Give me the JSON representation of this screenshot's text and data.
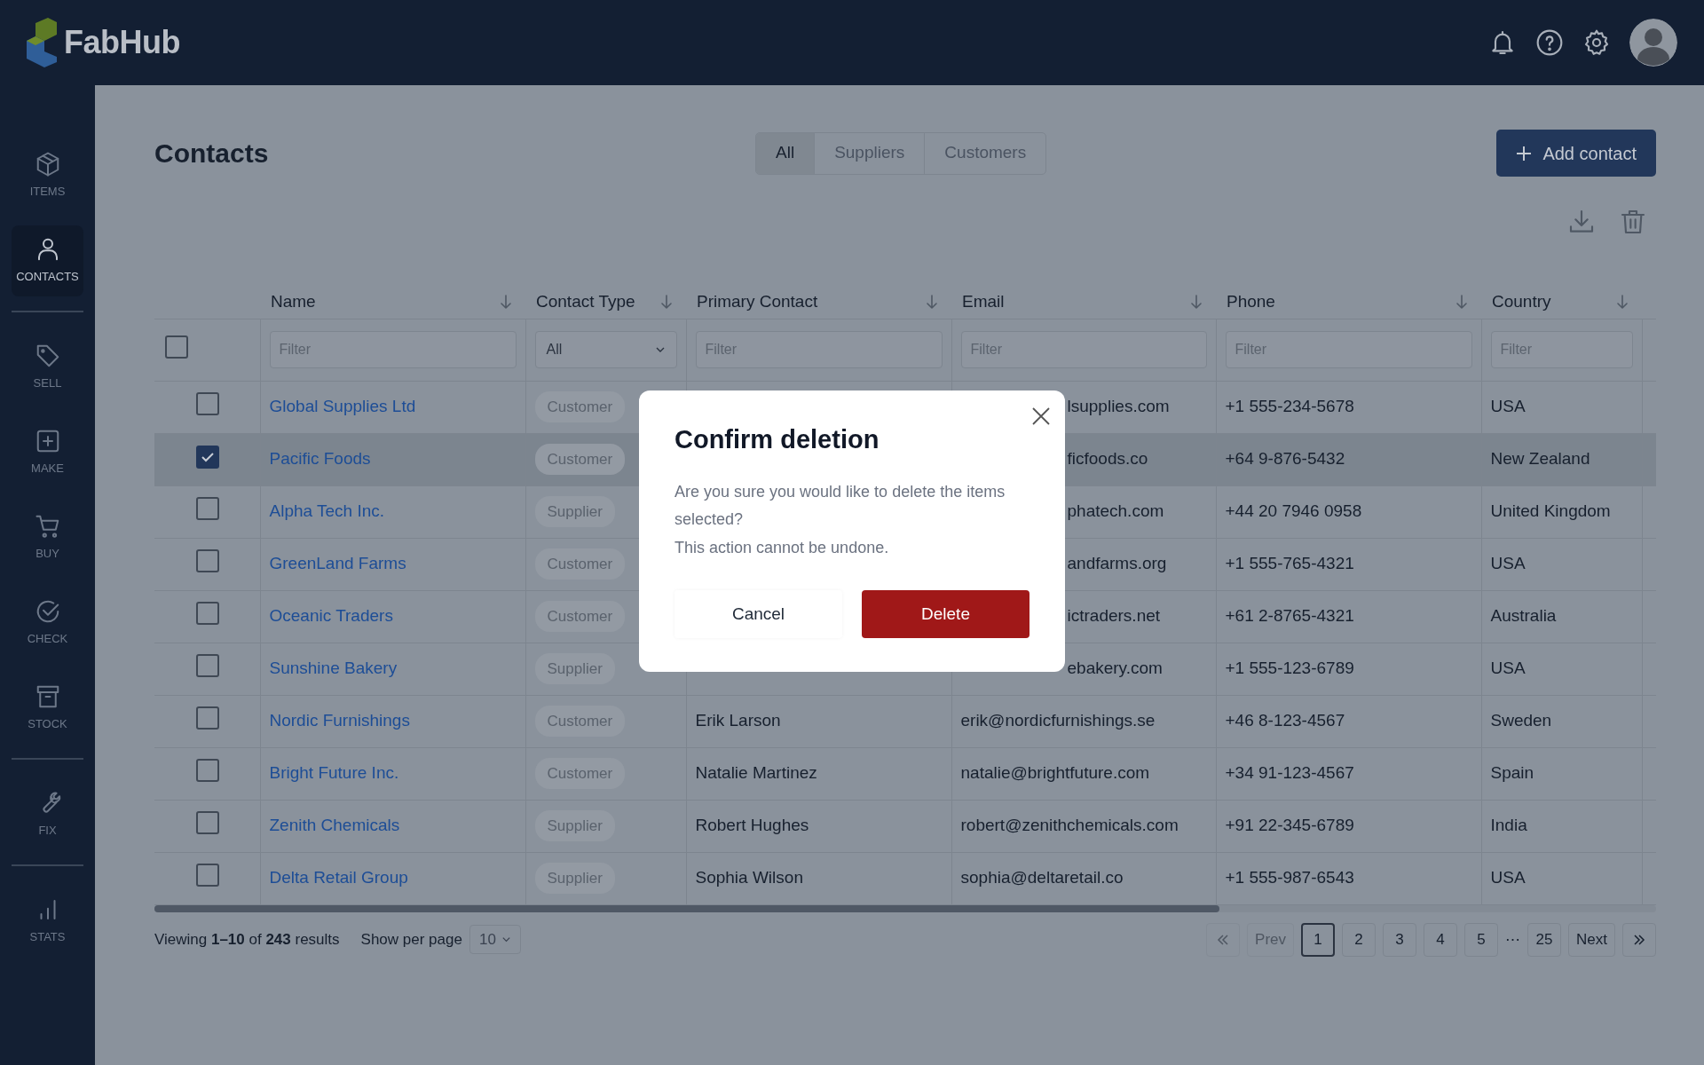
{
  "app": {
    "name": "FabHub"
  },
  "sidebar": {
    "groups": [
      {
        "items": [
          {
            "label": "ITEMS",
            "selected": false
          },
          {
            "label": "CONTACTS",
            "selected": true
          }
        ]
      },
      {
        "items": [
          {
            "label": "SELL",
            "selected": false
          },
          {
            "label": "MAKE",
            "selected": false
          },
          {
            "label": "BUY",
            "selected": false
          },
          {
            "label": "CHECK",
            "selected": false
          },
          {
            "label": "STOCK",
            "selected": false
          }
        ]
      },
      {
        "items": [
          {
            "label": "FIX",
            "selected": false
          }
        ]
      },
      {
        "items": [
          {
            "label": "STATS",
            "selected": false
          }
        ]
      }
    ]
  },
  "page": {
    "title": "Contacts",
    "tabs": [
      {
        "label": "All",
        "selected": true
      },
      {
        "label": "Suppliers",
        "selected": false
      },
      {
        "label": "Customers",
        "selected": false
      }
    ],
    "add_button": "Add contact"
  },
  "table": {
    "columns": [
      {
        "label": "Name"
      },
      {
        "label": "Contact Type"
      },
      {
        "label": "Primary  Contact"
      },
      {
        "label": "Email"
      },
      {
        "label": "Phone"
      },
      {
        "label": "Country"
      }
    ],
    "select_all": {
      "checked": false
    },
    "filters": [
      {
        "kind": "text",
        "placeholder": "Filter"
      },
      {
        "kind": "select",
        "value": "All"
      },
      {
        "kind": "text",
        "placeholder": "Filter"
      },
      {
        "kind": "text",
        "placeholder": "Filter"
      },
      {
        "kind": "text",
        "placeholder": "Filter"
      },
      {
        "kind": "text",
        "placeholder": "Filter"
      }
    ],
    "rows": [
      {
        "selected": false,
        "name": "Global Supplies Ltd",
        "contact_type": "Customer",
        "email": "lsupplies.com",
        "phone": "+1 555-234-5678",
        "country": "USA"
      },
      {
        "selected": true,
        "name": "Pacific Foods",
        "contact_type": "Customer",
        "email": "ficfoods.co",
        "phone": "+64 9-876-5432",
        "country": "New Zealand"
      },
      {
        "selected": false,
        "name": "Alpha Tech Inc.",
        "contact_type": "Supplier",
        "email": "phatech.com",
        "phone": "+44 20 7946 0958",
        "country": "United Kingdom"
      },
      {
        "selected": false,
        "name": "GreenLand Farms",
        "contact_type": "Customer",
        "email": "andfarms.org",
        "phone": "+1 555-765-4321",
        "country": "USA"
      },
      {
        "selected": false,
        "name": "Oceanic Traders",
        "contact_type": "Customer",
        "email": "ictraders.net",
        "phone": "+61 2-8765-4321",
        "country": "Australia"
      },
      {
        "selected": false,
        "name": "Sunshine Bakery",
        "contact_type": "Supplier",
        "email": "ebakery.com",
        "phone": "+1 555-123-6789",
        "country": "USA"
      },
      {
        "selected": false,
        "name": "Nordic Furnishings",
        "contact_type": "Customer",
        "primary_contact": "Erik Larson",
        "email": "erik@nordicfurnishings.se",
        "phone": "+46 8-123-4567",
        "country": "Sweden"
      },
      {
        "selected": false,
        "name": "Bright Future Inc.",
        "contact_type": "Customer",
        "primary_contact": "Natalie Martinez",
        "email": "natalie@brightfuture.com",
        "phone": "+34 91-123-4567",
        "country": "Spain"
      },
      {
        "selected": false,
        "name": "Zenith Chemicals",
        "contact_type": "Supplier",
        "primary_contact": "Robert Hughes",
        "email": "robert@zenithchemicals.com",
        "phone": "+91 22-345-6789",
        "country": "India"
      },
      {
        "selected": false,
        "name": "Delta Retail Group",
        "contact_type": "Supplier",
        "primary_contact": "Sophia Wilson",
        "email": "sophia@deltaretail.co",
        "phone": "+1 555-987-6543",
        "country": "USA"
      }
    ]
  },
  "footer": {
    "summary": "Viewing **1–10** of **243** results",
    "per_page_label": "Show per page",
    "per_page": "10",
    "pagination": {
      "first": {
        "disabled": true
      },
      "prev": {
        "label": "Prev",
        "disabled": true
      },
      "pages": [
        {
          "kind": "page",
          "label": "1",
          "selected": true
        },
        {
          "kind": "page",
          "label": "2",
          "selected": false
        },
        {
          "kind": "page",
          "label": "3",
          "selected": false
        },
        {
          "kind": "page",
          "label": "4",
          "selected": false
        },
        {
          "kind": "page",
          "label": "5",
          "selected": false
        },
        {
          "kind": "gap",
          "label": "⋯"
        },
        {
          "kind": "page",
          "label": "25",
          "selected": false
        }
      ],
      "next": {
        "label": "Next",
        "disabled": false
      },
      "last": {
        "disabled": false
      }
    }
  },
  "dialog": {
    "title": "Confirm deletion",
    "message": [
      "Are you sure you would like to delete the items selected?",
      "This action cannot be undone."
    ],
    "buttons": [
      {
        "label": "Cancel",
        "kind": "secondary"
      },
      {
        "label": "Delete",
        "kind": "danger"
      }
    ]
  }
}
